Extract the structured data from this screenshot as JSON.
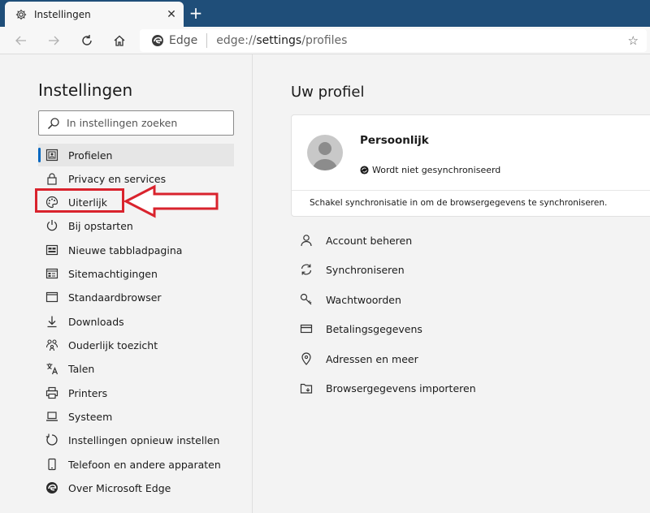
{
  "tab": {
    "title": "Instellingen",
    "close": "✕",
    "new_tab": "+"
  },
  "address": {
    "brand": "Edge",
    "url_prefix": "edge://",
    "url_bold": "settings",
    "url_suffix": "/profiles"
  },
  "sidebar": {
    "title": "Instellingen",
    "search_placeholder": "In instellingen zoeken",
    "items": [
      {
        "label": "Profielen",
        "icon": "profile-card-icon",
        "active": true
      },
      {
        "label": "Privacy en services",
        "icon": "lock-icon"
      },
      {
        "label": "Uiterlijk",
        "icon": "palette-icon"
      },
      {
        "label": "Bij opstarten",
        "icon": "power-icon"
      },
      {
        "label": "Nieuwe tabbladpagina",
        "icon": "new-tab-page-icon"
      },
      {
        "label": "Sitemachtigingen",
        "icon": "site-permissions-icon"
      },
      {
        "label": "Standaardbrowser",
        "icon": "browser-window-icon"
      },
      {
        "label": "Downloads",
        "icon": "download-icon"
      },
      {
        "label": "Ouderlijk toezicht",
        "icon": "family-icon"
      },
      {
        "label": "Talen",
        "icon": "languages-icon"
      },
      {
        "label": "Printers",
        "icon": "printer-icon"
      },
      {
        "label": "Systeem",
        "icon": "laptop-icon"
      },
      {
        "label": "Instellingen opnieuw instellen",
        "icon": "reset-icon"
      },
      {
        "label": "Telefoon en andere apparaten",
        "icon": "phone-icon"
      },
      {
        "label": "Over Microsoft Edge",
        "icon": "edge-logo-icon"
      }
    ]
  },
  "main": {
    "title": "Uw profiel",
    "profile": {
      "name": "Persoonlijk",
      "sync_status": "Wordt niet gesynchroniseerd",
      "footer": "Schakel synchronisatie in om de browsergegevens te synchroniseren."
    },
    "links": [
      {
        "label": "Account beheren",
        "icon": "person-icon"
      },
      {
        "label": "Synchroniseren",
        "icon": "sync-icon"
      },
      {
        "label": "Wachtwoorden",
        "icon": "key-icon"
      },
      {
        "label": "Betalingsgegevens",
        "icon": "credit-card-icon"
      },
      {
        "label": "Adressen en meer",
        "icon": "location-pin-icon"
      },
      {
        "label": "Browsergegevens importeren",
        "icon": "import-icon"
      }
    ]
  },
  "colors": {
    "titlebar": "#1f4e79",
    "accent": "#0067c0",
    "annotation": "#d9232d"
  }
}
